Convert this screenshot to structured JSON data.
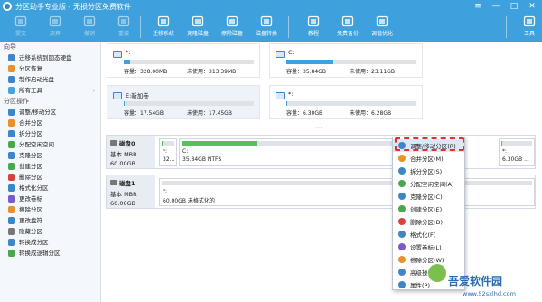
{
  "window": {
    "title": "分区助手专业版 - 无损分区免费软件",
    "controls": [
      "≡",
      "—",
      "□",
      "✕"
    ]
  },
  "toolbar": {
    "items": [
      {
        "label": "提交",
        "icon": "commit-icon",
        "dim": true
      },
      {
        "label": "放弃",
        "icon": "discard-icon",
        "dim": true
      },
      {
        "label": "撤销",
        "icon": "undo-icon",
        "dim": true
      },
      {
        "label": "重做",
        "icon": "redo-icon",
        "dim": true
      },
      {
        "label": "迁移系统",
        "icon": "migrate-os-icon"
      },
      {
        "label": "克隆磁盘",
        "icon": "clone-disk-icon"
      },
      {
        "label": "擦除磁盘",
        "icon": "wipe-disk-icon"
      },
      {
        "label": "磁盘转换",
        "icon": "disk-convert-icon"
      },
      {
        "label": "教程",
        "icon": "tutorial-icon"
      },
      {
        "label": "免费备份",
        "icon": "backup-icon"
      },
      {
        "label": "调谐优化",
        "icon": "optimize-icon"
      },
      {
        "label": "工具",
        "icon": "tools-icon"
      }
    ]
  },
  "sidebar": {
    "wizard_header": "向导",
    "wizard_items": [
      {
        "label": "迁移系统到固态硬盘",
        "color": "#3e86c8"
      },
      {
        "label": "分区恢复",
        "color": "#e8922c"
      },
      {
        "label": "制作启动光盘",
        "color": "#3e86c8"
      },
      {
        "label": "所有工具",
        "color": "#4aa3df",
        "collapse": true
      }
    ],
    "ops_header": "分区操作",
    "ops_items": [
      {
        "label": "调整/移动分区",
        "color": "#3e86c8"
      },
      {
        "label": "合并分区",
        "color": "#e8922c"
      },
      {
        "label": "拆分分区",
        "color": "#3e86c8"
      },
      {
        "label": "分配空闲空间",
        "color": "#49a84c"
      },
      {
        "label": "克隆分区",
        "color": "#3e86c8"
      },
      {
        "label": "创建分区",
        "color": "#49a84c"
      },
      {
        "label": "删除分区",
        "color": "#d8413d"
      },
      {
        "label": "格式化分区",
        "color": "#3e86c8"
      },
      {
        "label": "更改卷标",
        "color": "#7a5cc8"
      },
      {
        "label": "擦除分区",
        "color": "#e8922c"
      },
      {
        "label": "更改盘符",
        "color": "#3e86c8"
      },
      {
        "label": "隐藏分区",
        "color": "#777777"
      },
      {
        "label": "转换成分区",
        "color": "#3e86c8"
      },
      {
        "label": "转换成逻辑分区",
        "color": "#49a84c"
      }
    ]
  },
  "cards": [
    {
      "name": "*:",
      "cap": "容量：328.00MB",
      "free": "未使用：313.39MB",
      "fill": 0.05,
      "selected": false
    },
    {
      "name": "C:",
      "cap": "容量：35.84GB",
      "free": "未使用：23.11GB",
      "fill": 0.36,
      "selected": false
    },
    {
      "name": "E:新加卷",
      "cap": "容量：17.54GB",
      "free": "未使用：17.45GB",
      "fill": 0.01,
      "selected": true
    },
    {
      "name": "*:",
      "cap": "容量：6.30GB",
      "free": "未使用：6.28GB",
      "fill": 0.01,
      "selected": false
    }
  ],
  "disks": [
    {
      "name": "磁盘0",
      "type": "基本 MBR",
      "size": "60.00GB",
      "partitions": [
        {
          "name": "*:",
          "info": "32...",
          "fill": 0.1,
          "highlight": false
        },
        {
          "name": "C:",
          "info": "35.84GB NTFS",
          "fill": 0.36,
          "highlight": false
        },
        {
          "name": "E:新加卷",
          "info": "",
          "fill": 0.01,
          "highlight": true
        },
        {
          "name": "*:",
          "info": "6.30GB ...",
          "fill": 0.02,
          "highlight": false
        }
      ]
    },
    {
      "name": "磁盘1",
      "type": "基本 MBR",
      "size": "60.00GB",
      "partitions": [
        {
          "name": "*:",
          "info": "60.00GB 未格式化的",
          "fill": 0,
          "highlight": false
        }
      ]
    }
  ],
  "context_menu": [
    {
      "label": "调整/移动分区(R)",
      "color": "#3e86c8",
      "active": true
    },
    {
      "label": "合并分区(M)",
      "color": "#e8922c"
    },
    {
      "label": "拆分分区(S)",
      "color": "#3e86c8"
    },
    {
      "label": "分配空闲空间(A)",
      "color": "#49a84c"
    },
    {
      "label": "克隆分区(C)",
      "color": "#3e86c8"
    },
    {
      "label": "创建分区(E)",
      "color": "#49a84c"
    },
    {
      "label": "删除分区(D)",
      "color": "#d8413d"
    },
    {
      "label": "格式化(F)",
      "color": "#3e86c8"
    },
    {
      "label": "设置卷标(L)",
      "color": "#7a5cc8"
    },
    {
      "label": "擦除分区(W)",
      "color": "#e8922c"
    },
    {
      "label": "高级操作(I)",
      "color": "#3e86c8"
    },
    {
      "label": "属性(P)",
      "color": "#3e86c8"
    }
  ],
  "watermark": {
    "text": "吾爱软件园",
    "url": "www.52sxlhd.com"
  }
}
